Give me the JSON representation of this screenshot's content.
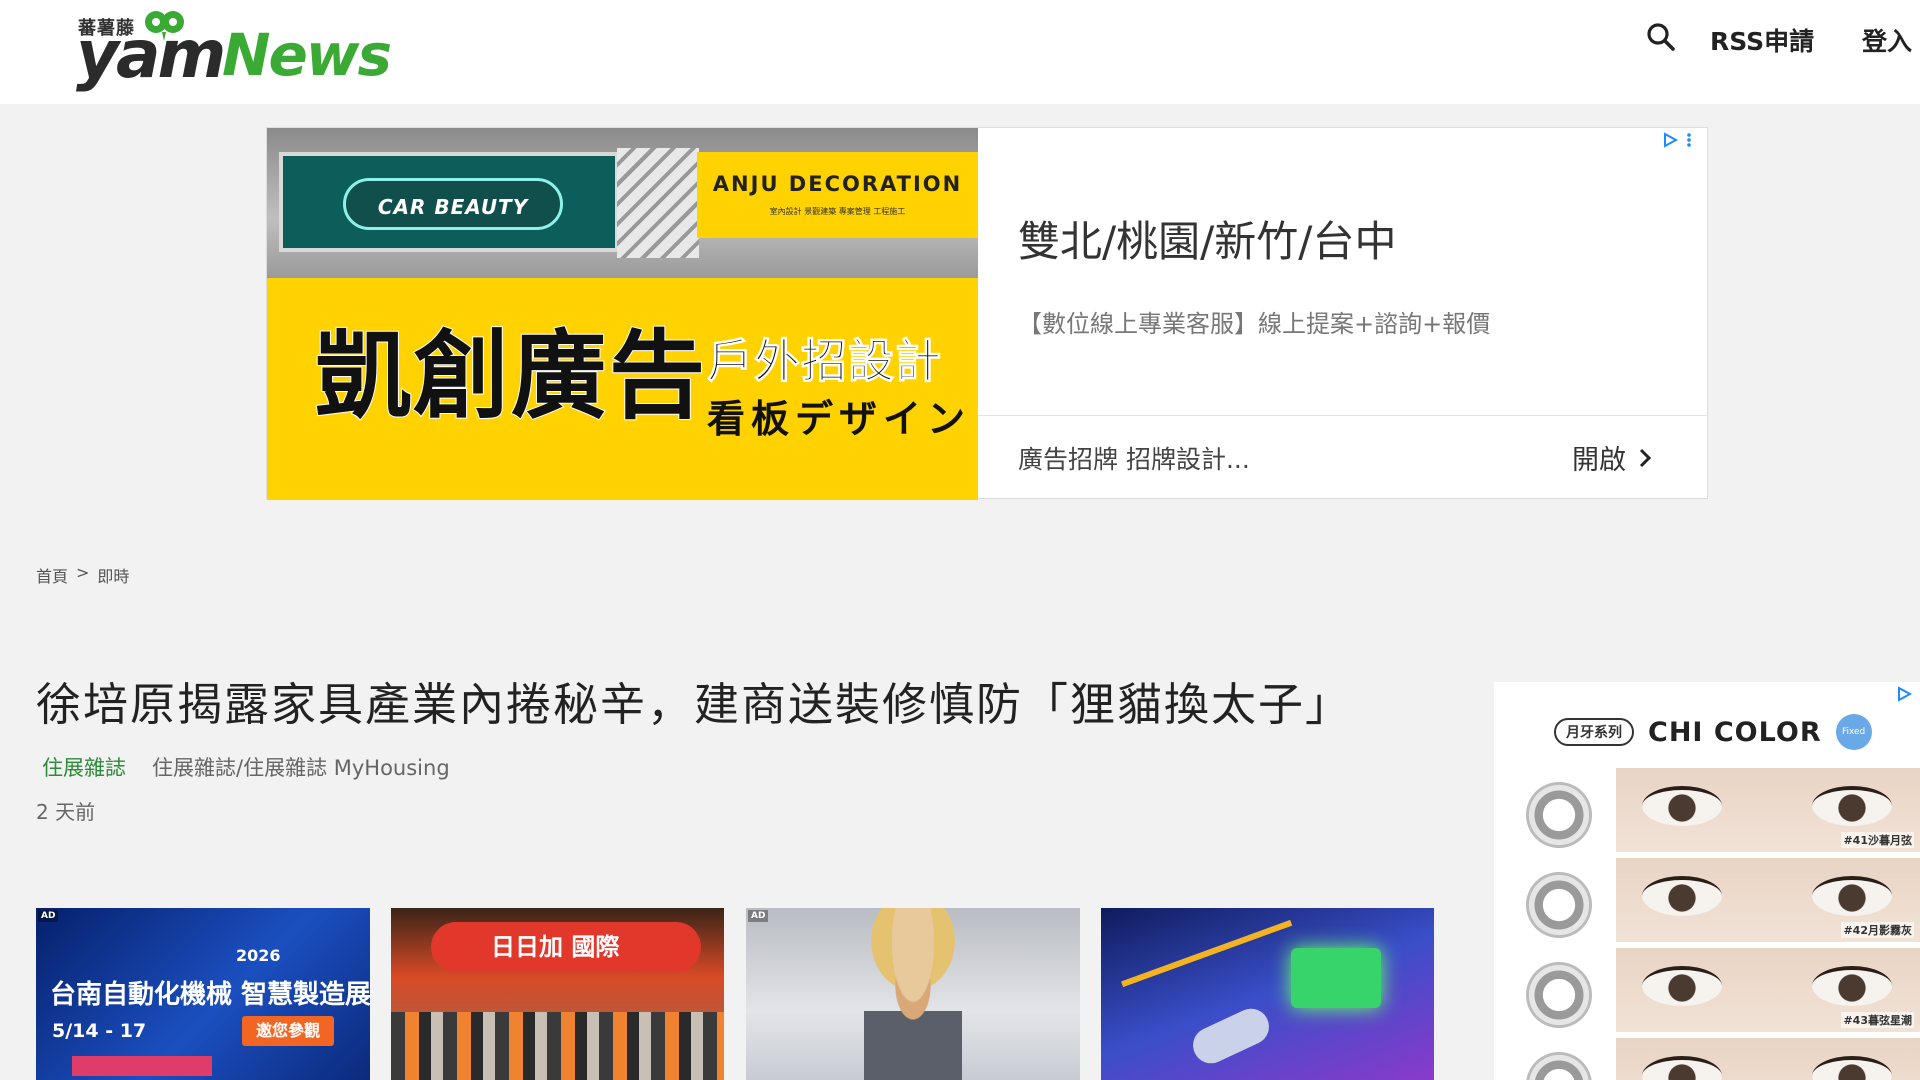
{
  "header": {
    "logo_cn": "蕃薯藤",
    "logo_yam": "yam",
    "logo_news": "News",
    "rss_label": "RSS申請",
    "login_label": "登入"
  },
  "top_ad": {
    "image": {
      "store_left_text": "CAR BEAUTY",
      "store_right_text": "ANJU DECORATION",
      "store_right_sub": "室內設計 景觀建築 專案管理 工程施工",
      "big_title": "凱創廣告",
      "sub_line1": "戶外招設計",
      "sub_line2": "看板デザイン"
    },
    "title": "雙北/桃園/新竹/台中",
    "description": "【數位線上專業客服】線上提案+諮詢+報價",
    "footer_text": "廣告招牌 招牌設計...",
    "open_label": "開啟"
  },
  "breadcrumb": {
    "home": "首頁",
    "separator": ">",
    "current": "即時"
  },
  "article": {
    "title": "徐培原揭露家具產業內捲秘辛，建商送裝修慎防「狸貓換太子」",
    "source": "住展雜誌",
    "author": "住展雜誌/住展雜誌 MyHousing",
    "time": "2 天前"
  },
  "thumbnails": [
    {
      "ad_tag": "AD",
      "year": "2026",
      "title": "台南自動化機械 智慧製造展",
      "date": "5/14 - 17",
      "button": "邀您參觀"
    },
    {
      "sign": "日日加 國際"
    },
    {
      "ad_tag": "AD"
    },
    {}
  ],
  "side_ad": {
    "series_label": "月牙系列",
    "brand": "CHI COLOR",
    "fixed_badge": "Fixed",
    "products": [
      {
        "code": "#41沙暮月弦"
      },
      {
        "code": "#42月影霧灰"
      },
      {
        "code": "#43暮弦星潮"
      }
    ]
  }
}
